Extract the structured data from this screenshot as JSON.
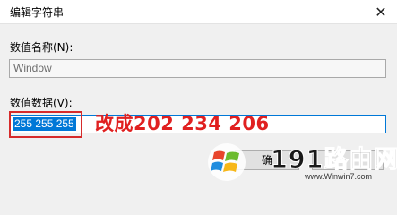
{
  "window": {
    "title": "编辑字符串",
    "close_glyph": "✕"
  },
  "value_name": {
    "label": "数值名称(N):",
    "value": "Window"
  },
  "value_data": {
    "label": "数值数据(V):",
    "value": "255 255 255"
  },
  "annotation": {
    "text": "改成202 234 206",
    "color": "#e02020"
  },
  "buttons": {
    "ok_label": "确"
  },
  "watermark": {
    "brand": "191路由网",
    "url": "www.Winwin7.com"
  },
  "colors": {
    "accent": "#0078d7",
    "highlight_border": "#d62b2b"
  }
}
